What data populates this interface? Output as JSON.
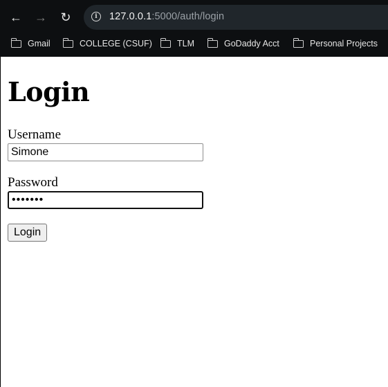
{
  "browser": {
    "nav": {
      "back_icon": "arrow-left-icon",
      "forward_icon": "arrow-right-icon",
      "reload_icon": "reload-icon"
    },
    "address_bar": {
      "site_info_icon": "info-icon",
      "host": "127.0.0.1",
      "path": ":5000/auth/login"
    },
    "bookmarks": [
      {
        "label": "Gmail",
        "icon": "folder-icon"
      },
      {
        "label": "COLLEGE (CSUF)",
        "icon": "folder-icon"
      },
      {
        "label": "TLM",
        "icon": "folder-icon"
      },
      {
        "label": "GoDaddy Acct",
        "icon": "folder-icon"
      },
      {
        "label": "Personal Projects",
        "icon": "folder-icon"
      }
    ],
    "colors": {
      "chrome_bg": "#0d0f11",
      "omnibox_bg": "#20262b"
    }
  },
  "page": {
    "title": "Login",
    "form": {
      "username_label": "Username",
      "username_value": "Simone",
      "password_label": "Password",
      "password_value": "•••••••",
      "submit_label": "Login"
    }
  }
}
